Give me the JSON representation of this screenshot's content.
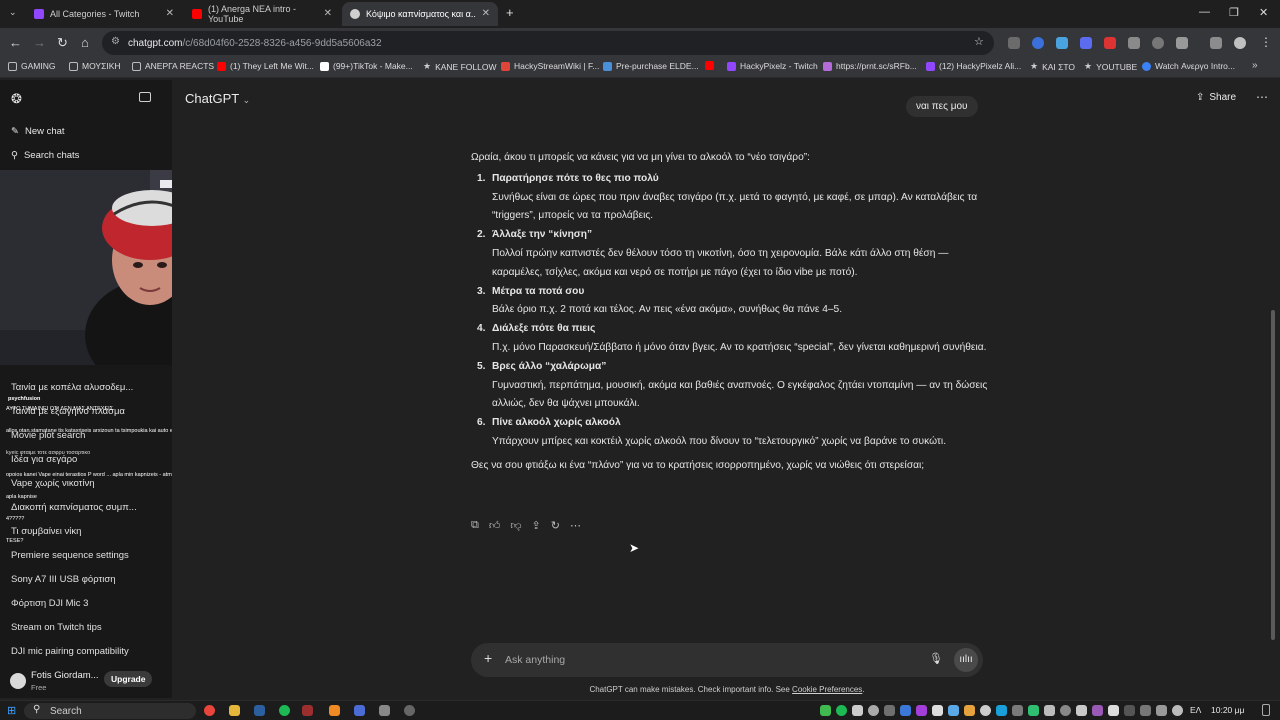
{
  "browser": {
    "tabs": [
      {
        "title": "All Categories - Twitch",
        "color": "#9146ff"
      },
      {
        "title": "(1) Anerga NEA intro - YouTube",
        "color": "#ff0000"
      },
      {
        "title": "Κόψιμο καπνίσματος και α...",
        "color": "#d0d0d0"
      }
    ],
    "url_host": "chatgpt.com",
    "url_path": "/c/68d04f60-2528-8326-a456-9dd5a5606a32",
    "bookmarks": [
      {
        "label": "GAMING",
        "color": "#c9c9c9"
      },
      {
        "label": "ΜΟΥΣΙΚΗ",
        "color": "#c9c9c9"
      },
      {
        "label": "ΑΝΕΡΓΑ REACTS",
        "color": "#c9c9c9"
      },
      {
        "label": "(1) They Left Me Wit...",
        "color": "#ff0000"
      },
      {
        "label": "(99+)TikTok - Make...",
        "color": "#ffffff"
      },
      {
        "label": "KANE FOLLOW",
        "color": "#c9c9c9"
      },
      {
        "label": "HackyStreamWiki | F...",
        "color": "#e0453a"
      },
      {
        "label": "Pre-purchase ELDE...",
        "color": "#4a90d9"
      },
      {
        "label": "",
        "color": "#ff0000"
      },
      {
        "label": "HackyPixelz - Twitch",
        "color": "#9146ff"
      },
      {
        "label": "https://prnt.sc/sRFb...",
        "color": "#b36bd9"
      },
      {
        "label": "(12) HackyPixelz Ali...",
        "color": "#9146ff"
      },
      {
        "label": "ΚΑΙ ΣΤΟ",
        "color": "#c9c9c9"
      },
      {
        "label": "YOUTUBE",
        "color": "#c9c9c9"
      },
      {
        "label": "Watch Ανεργο Intro...",
        "color": "#3b82f6"
      }
    ]
  },
  "sidebar": {
    "new_chat": "New chat",
    "search_chats": "Search chats",
    "chats": [
      "Ταινία με κοπέλα αλυσοδεμ...",
      "Ταινία με εξωγήινο πλάσμα",
      "Movie plot search",
      "Ιδέα για σεγάρο",
      "Vape χωρίς νικοτίνη",
      "Διακοπή καπνίσματος συμπ...",
      "Τι συμβαίνει νίκη",
      "Premiere sequence settings",
      "Sony A7 III USB φόρτιση",
      "Φόρτιση DJI Mic 3",
      "Stream on Twitch tips",
      "DJI mic pairing compatibility"
    ],
    "user_name": "Fotis Giordam...",
    "user_plan": "Free",
    "upgrade": "Upgrade",
    "stream_chat_overlay": [
      {
        "text": "psychfusion",
        "color": "#ffffff"
      },
      {
        "text": "AYTO THMAINEI OTI ΔΕΝ ΜΑΣ ΑΝΤΕΧΕΙΣ",
        "color": "#ffffff"
      },
      {
        "text": "allos otan stamatane tis kataxriseis arxizoun ta tsimpoukia kai auto einai mia lush",
        "color": "#ffffff"
      },
      {
        "text": "kyeic φταιμε τοτε ασφρυ τοσαρτικο",
        "color": "#dddddd"
      },
      {
        "text": "opoios kanei Vape einai terastios P word ... apla min kapnizeis - atmizeis",
        "color": "#ffffff"
      },
      {
        "text": "apla kapnise",
        "color": "#ffffff"
      },
      {
        "text": "4?????",
        "color": "#ffffff"
      },
      {
        "text": "TESE?",
        "color": "#ffffff"
      }
    ]
  },
  "header": {
    "model": "ChatGPT",
    "share": "Share"
  },
  "conversation": {
    "user_message": "ναι πες μου",
    "intro": "Ωραία, άκου τι μπορείς να κάνεις για να μη γίνει το αλκοόλ το “νέο τσιγάρο”:",
    "steps": [
      {
        "num": "1.",
        "title": "Παρατήρησε πότε το θες πιο πολύ",
        "body": "Συνήθως είναι σε ώρες που πριν άναβες τσιγάρο (π.χ. μετά το φαγητό, με καφέ, σε μπαρ). Αν καταλάβεις τα “triggers”, μπορείς να τα προλάβεις."
      },
      {
        "num": "2.",
        "title": "Άλλαξε την “κίνηση”",
        "body": "Πολλοί πρώην καπνιστές δεν θέλουν τόσο τη νικοτίνη, όσο τη χειρονομία. Βάλε κάτι άλλο στη θέση — καραμέλες, τσίχλες, ακόμα και νερό σε ποτήρι με πάγο (έχει το ίδιο vibe με ποτό)."
      },
      {
        "num": "3.",
        "title": "Μέτρα τα ποτά σου",
        "body": "Βάλε όριο π.χ. 2 ποτά και τέλος. Αν πεις «ένα ακόμα», συνήθως θα πάνε 4–5."
      },
      {
        "num": "4.",
        "title": "Διάλεξε πότε θα πιεις",
        "body": "Π.χ. μόνο Παρασκευή/Σάββατο ή μόνο όταν βγεις. Αν το κρατήσεις “special”, δεν γίνεται καθημερινή συνήθεια."
      },
      {
        "num": "5.",
        "title": "Βρες άλλο “χαλάρωμα”",
        "body": "Γυμναστική, περπάτημα, μουσική, ακόμα και βαθιές αναπνοές. Ο εγκέφαλος ζητάει ντοπαμίνη — αν τη δώσεις αλλιώς, δεν θα ψάχνει μπουκάλι."
      },
      {
        "num": "6.",
        "title": "Πίνε αλκοόλ χωρίς αλκοόλ",
        "body": "Υπάρχουν μπίρες και κοκτέιλ χωρίς αλκοόλ που δίνουν το “τελετουργικό” χωρίς να βαράνε το συκώτι."
      }
    ],
    "closing": "Θες να σου φτιάξω κι ένα “πλάνο” για να το κρατήσεις ισορροπημένο, χωρίς να νιώθεις ότι στερείσαι;"
  },
  "composer": {
    "placeholder": "Ask anything",
    "disclaimer_text": "ChatGPT can make mistakes. Check important info. See ",
    "disclaimer_link": "Cookie Preferences",
    "disclaimer_end": "."
  },
  "taskbar": {
    "search": "Search",
    "lang": "ΕΛ",
    "time": "10:20 μμ"
  }
}
